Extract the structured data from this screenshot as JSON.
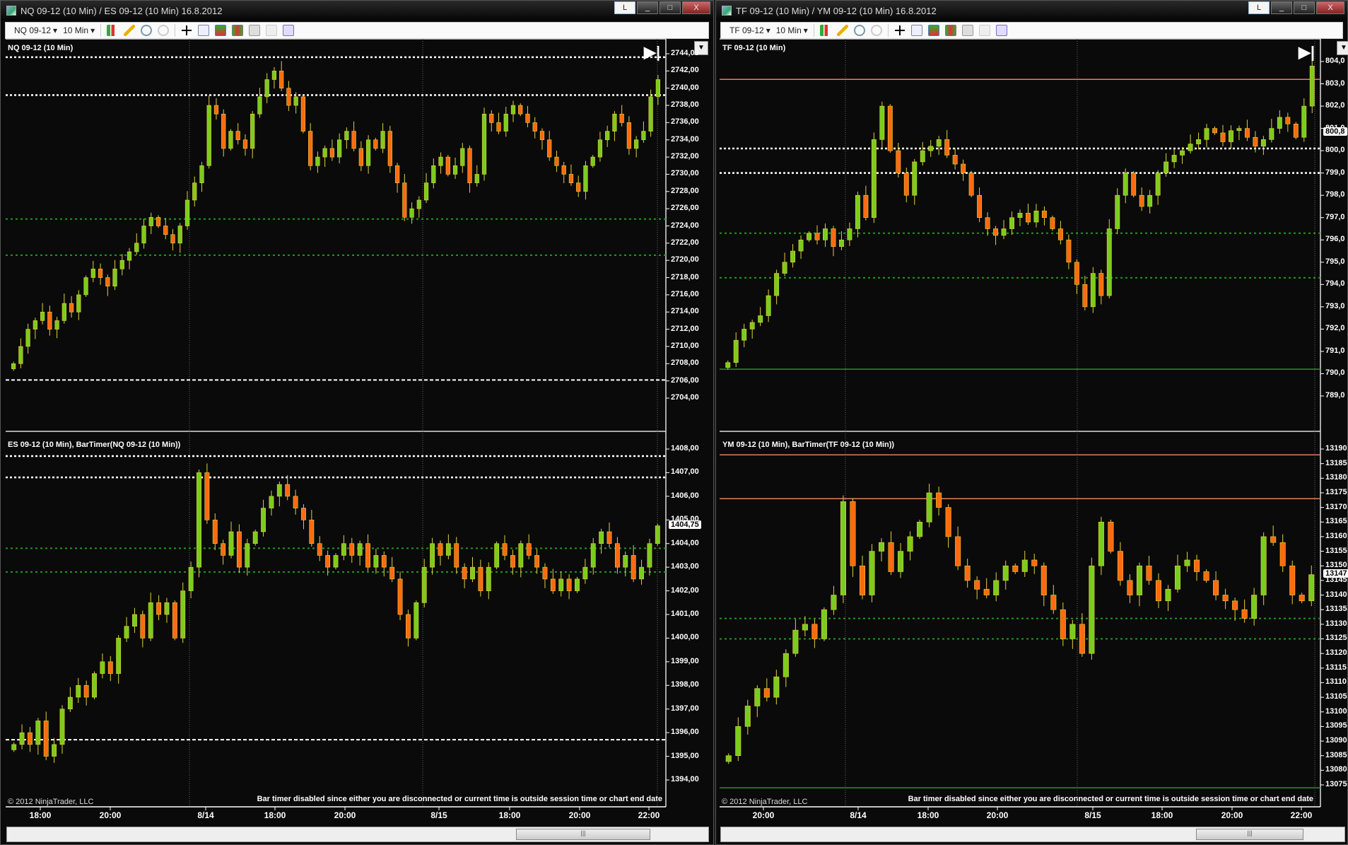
{
  "windows": [
    {
      "title": "NQ 09-12 (10 Min) / ES 09-12 (10 Min)  16.8.2012",
      "instrument": "NQ 09-12",
      "interval": "10 Min",
      "copyright": "© 2012 NinjaTrader, LLC",
      "bar_timer_msg": "Bar timer disabled since either you are disconnected or current time is outside session time or chart end date",
      "time_labels": [
        "18:00",
        "20:00",
        "8/14",
        "18:00",
        "20:00",
        "8/15",
        "18:00",
        "20:00",
        "22:00"
      ]
    },
    {
      "title": "TF 09-12 (10 Min) / YM 09-12 (10 Min)  16.8.2012",
      "instrument": "TF 09-12",
      "interval": "10 Min",
      "copyright": "© 2012 NinjaTrader, LLC",
      "bar_timer_msg": "Bar timer disabled since either you are disconnected or current time is outside session time or chart end date",
      "time_labels": [
        "20:00",
        "8/14",
        "18:00",
        "20:00",
        "8/15",
        "18:00",
        "20:00",
        "22:00"
      ]
    }
  ],
  "window_buttons": {
    "l": "L",
    "min": "_",
    "max": "□",
    "close": "X"
  },
  "colors": {
    "up": "#7ccc1c",
    "down": "#ff6a10",
    "wick": "#e0d040",
    "grid_green": "#1f9a1f",
    "salmon": "#e08060"
  },
  "chart_data": [
    {
      "type": "candlestick",
      "title": "NQ 09-12 (10 Min)",
      "ylim": [
        2704,
        2744
      ],
      "ticks": [
        "2744,00",
        "2742,00",
        "2740,00",
        "2738,00",
        "2736,00",
        "2734,00",
        "2732,00",
        "2730,00",
        "2728,00",
        "2726,00",
        "2724,00",
        "2722,00",
        "2720,00",
        "2718,00",
        "2716,00",
        "2714,00",
        "2712,00",
        "2710,00",
        "2708,00",
        "2706,00",
        "2704,00"
      ],
      "tick_values": [
        2744,
        2742,
        2740,
        2738,
        2736,
        2734,
        2732,
        2730,
        2728,
        2726,
        2724,
        2722,
        2720,
        2718,
        2716,
        2714,
        2712,
        2710,
        2708,
        2706,
        2704
      ],
      "hlines": [
        {
          "v": 2743.6,
          "style": "white-dot"
        },
        {
          "v": 2739.2,
          "style": "white-dot"
        },
        {
          "v": 2724.8,
          "style": "green-dot"
        },
        {
          "v": 2720.6,
          "style": "green-dot"
        },
        {
          "v": 2706.1,
          "style": "white-dash"
        }
      ],
      "closes": [
        2708,
        2710,
        2712,
        2713,
        2714,
        2712,
        2713,
        2715,
        2714,
        2716,
        2718,
        2719,
        2718,
        2717,
        2719,
        2720,
        2721,
        2722,
        2724,
        2725,
        2724,
        2723,
        2722,
        2724,
        2727,
        2729,
        2731,
        2738,
        2737,
        2733,
        2735,
        2734,
        2733,
        2737,
        2739,
        2741,
        2742,
        2740,
        2738,
        2739,
        2735,
        2731,
        2732,
        2733,
        2732,
        2734,
        2735,
        2733,
        2731,
        2734,
        2733,
        2735,
        2731,
        2729,
        2725,
        2726,
        2727,
        2729,
        2731,
        2732,
        2730,
        2731,
        2733,
        2729,
        2730,
        2737,
        2736,
        2735,
        2737,
        2738,
        2737,
        2736,
        2735,
        2734,
        2732,
        2731,
        2730,
        2729,
        2728,
        2731,
        2732,
        2734,
        2735,
        2737,
        2736,
        2733,
        2734,
        2735,
        2739,
        2741
      ],
      "vol": 1.2
    },
    {
      "type": "candlestick",
      "title": "ES 09-12 (10 Min), BarTimer(NQ 09-12 (10 Min))",
      "ylim": [
        1394,
        1408
      ],
      "last_price": "1404,75",
      "last_value": 1404.75,
      "ticks": [
        "1408,00",
        "1407,00",
        "1406,00",
        "1405,00",
        "1404,00",
        "1403,00",
        "1402,00",
        "1401,00",
        "1400,00",
        "1399,00",
        "1398,00",
        "1397,00",
        "1396,00",
        "1395,00",
        "1394,00"
      ],
      "tick_values": [
        1408,
        1407,
        1406,
        1405,
        1404,
        1403,
        1402,
        1401,
        1400,
        1399,
        1398,
        1397,
        1396,
        1395,
        1394
      ],
      "hlines": [
        {
          "v": 1407.7,
          "style": "white-dot"
        },
        {
          "v": 1406.8,
          "style": "white-dot"
        },
        {
          "v": 1403.8,
          "style": "green-dot"
        },
        {
          "v": 1402.8,
          "style": "green-dot"
        },
        {
          "v": 1395.7,
          "style": "white-dash"
        }
      ],
      "closes": [
        1395.5,
        1396,
        1395.5,
        1396.5,
        1395,
        1395.5,
        1397,
        1397.5,
        1398,
        1397.5,
        1398.5,
        1399,
        1398.5,
        1400,
        1400.5,
        1401,
        1400,
        1401.5,
        1401,
        1401.5,
        1400,
        1402,
        1403,
        1407,
        1405,
        1404,
        1403.5,
        1404.5,
        1403,
        1404,
        1404.5,
        1405.5,
        1406,
        1406.5,
        1406,
        1405.5,
        1405,
        1404,
        1403.5,
        1403,
        1403.5,
        1404,
        1403.5,
        1404,
        1403,
        1403.5,
        1403,
        1402.5,
        1401,
        1400,
        1401.5,
        1403,
        1404,
        1403.5,
        1404,
        1403,
        1402.5,
        1403,
        1402,
        1403,
        1404,
        1403.5,
        1403,
        1404,
        1403.5,
        1403,
        1402.5,
        1402,
        1402.5,
        1402,
        1402.5,
        1403,
        1404,
        1404.5,
        1404,
        1403,
        1403.5,
        1402.5,
        1403,
        1404,
        1404.75
      ],
      "vol": 0.45
    },
    {
      "type": "candlestick",
      "title": "TF 09-12 (10 Min)",
      "ylim": [
        789,
        804
      ],
      "last_price": "800,8",
      "last_value": 800.8,
      "ticks": [
        "804,0",
        "803,0",
        "802,0",
        "801,0",
        "800,0",
        "799,0",
        "798,0",
        "797,0",
        "796,0",
        "795,0",
        "794,0",
        "793,0",
        "792,0",
        "791,0",
        "790,0",
        "789,0"
      ],
      "tick_values": [
        804,
        803,
        802,
        801,
        800,
        799,
        798,
        797,
        796,
        795,
        794,
        793,
        792,
        791,
        790,
        789
      ],
      "hlines": [
        {
          "v": 803.2,
          "style": "salmon"
        },
        {
          "v": 800.1,
          "style": "white-dot"
        },
        {
          "v": 799.0,
          "style": "white-dot"
        },
        {
          "v": 796.3,
          "style": "green-dot"
        },
        {
          "v": 794.3,
          "style": "green-dot"
        },
        {
          "v": 790.2,
          "style": "green-solid"
        }
      ],
      "closes": [
        790.5,
        791.5,
        792,
        792.3,
        792.6,
        793.5,
        794.5,
        795,
        795.5,
        796,
        796.3,
        796,
        796.5,
        795.7,
        796,
        796.5,
        798,
        797,
        800.5,
        802,
        800,
        799,
        798,
        799.5,
        800,
        800.2,
        800.5,
        799.8,
        799.4,
        799,
        798,
        797,
        796.5,
        796.2,
        796.5,
        797,
        797.2,
        796.8,
        797.3,
        797,
        796.5,
        796,
        795,
        794,
        793,
        794.5,
        793.5,
        796.5,
        798,
        799,
        798,
        797.5,
        798,
        799,
        799.5,
        799.8,
        800,
        800.3,
        800.5,
        801,
        800.8,
        800.4,
        800.9,
        801,
        800.6,
        800.2,
        800.5,
        801,
        801.5,
        801.2,
        800.6,
        802,
        803.8
      ],
      "vol": 0.45
    },
    {
      "type": "candlestick",
      "title": "YM 09-12 (10 Min), BarTimer(TF 09-12 (10 Min))",
      "ylim": [
        13075,
        13190
      ],
      "last_price": "13147",
      "last_value": 13147,
      "ticks": [
        "13190",
        "13185",
        "13180",
        "13175",
        "13170",
        "13165",
        "13160",
        "13155",
        "13150",
        "13145",
        "13140",
        "13135",
        "13130",
        "13125",
        "13120",
        "13115",
        "13110",
        "13105",
        "13100",
        "13095",
        "13090",
        "13085",
        "13080",
        "13075"
      ],
      "tick_values": [
        13190,
        13185,
        13180,
        13175,
        13170,
        13165,
        13160,
        13155,
        13150,
        13145,
        13140,
        13135,
        13130,
        13125,
        13120,
        13115,
        13110,
        13105,
        13100,
        13095,
        13090,
        13085,
        13080,
        13075
      ],
      "hlines": [
        {
          "v": 13188,
          "style": "salmon"
        },
        {
          "v": 13173,
          "style": "salmon"
        },
        {
          "v": 13132,
          "style": "green-dot"
        },
        {
          "v": 13125,
          "style": "green-dot"
        },
        {
          "v": 13074,
          "style": "green-solid"
        }
      ],
      "closes": [
        13085,
        13095,
        13102,
        13108,
        13105,
        13112,
        13120,
        13128,
        13130,
        13125,
        13135,
        13140,
        13172,
        13150,
        13140,
        13155,
        13158,
        13148,
        13155,
        13160,
        13165,
        13175,
        13170,
        13160,
        13150,
        13145,
        13142,
        13140,
        13145,
        13150,
        13148,
        13152,
        13150,
        13140,
        13135,
        13125,
        13130,
        13120,
        13150,
        13165,
        13155,
        13145,
        13140,
        13150,
        13145,
        13138,
        13142,
        13150,
        13152,
        13148,
        13145,
        13140,
        13138,
        13135,
        13132,
        13140,
        13160,
        13158,
        13150,
        13140,
        13138,
        13147
      ],
      "vol": 4
    }
  ]
}
